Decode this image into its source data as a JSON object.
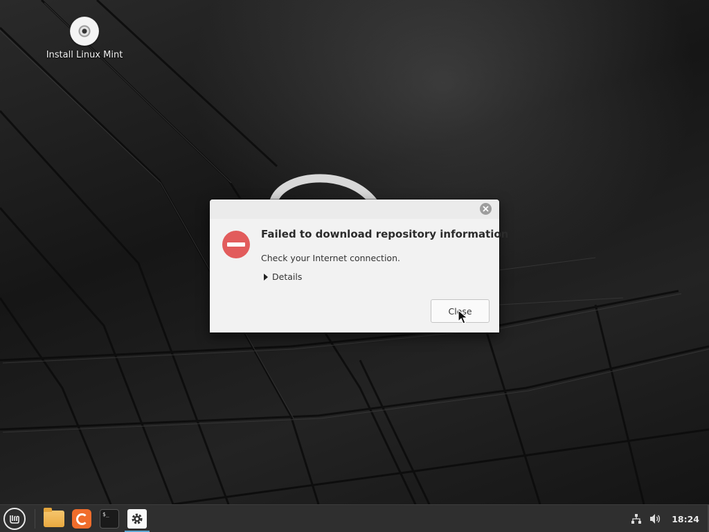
{
  "desktop": {
    "icons": [
      {
        "label": "Install Linux Mint"
      }
    ]
  },
  "dialog": {
    "title": "Failed to download repository information",
    "message": "Check your Internet connection.",
    "details_label": "Details",
    "close_button": "Close",
    "error_color": "#e25c5c"
  },
  "taskbar": {
    "menu": "mint-menu-icon",
    "launchers": [
      {
        "icon": "folder-icon"
      },
      {
        "icon": "firefox-icon"
      },
      {
        "icon": "terminal-icon"
      },
      {
        "icon": "settings-icon"
      }
    ],
    "tray": {
      "network": "network-icon",
      "volume": "volume-icon",
      "clock": "18:24"
    },
    "active_indicator_color": "#5fa8d3"
  }
}
